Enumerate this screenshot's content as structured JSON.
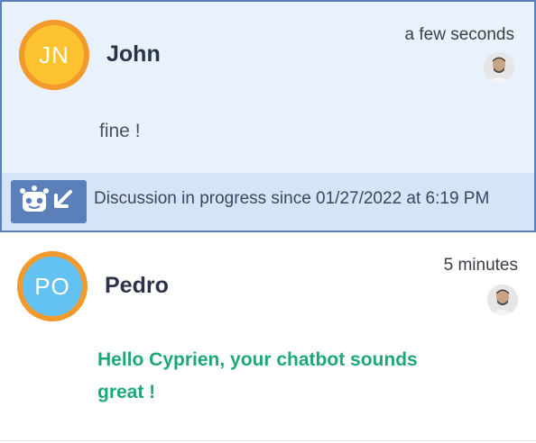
{
  "conversations": [
    {
      "initials": "JN",
      "name": "John",
      "time": "a few seconds",
      "message": "fine !",
      "status": "Discussion in progress since 01/27/2022 at 6:19 PM",
      "selected": true,
      "avatar_color": "#fcc230",
      "avatar_ring_color": "#f39a2c",
      "agent_icon": "agent-avatar-icon",
      "status_icons": [
        "bot-icon",
        "arrow-down-left-icon"
      ]
    },
    {
      "initials": "PO",
      "name": "Pedro",
      "time": "5 minutes",
      "message": "Hello Cyprien, your chatbot sounds great !",
      "selected": false,
      "avatar_color": "#64c2f3",
      "avatar_ring_color": "#f39a2c",
      "agent_icon": "agent-avatar-icon"
    }
  ],
  "colors": {
    "selected_background": "#e9f1fc",
    "selected_border": "#5b7fb9",
    "status_bar_background": "#d6e4f8",
    "bot_badge": "#5b7fb9",
    "highlight_message": "#1ea87a"
  }
}
